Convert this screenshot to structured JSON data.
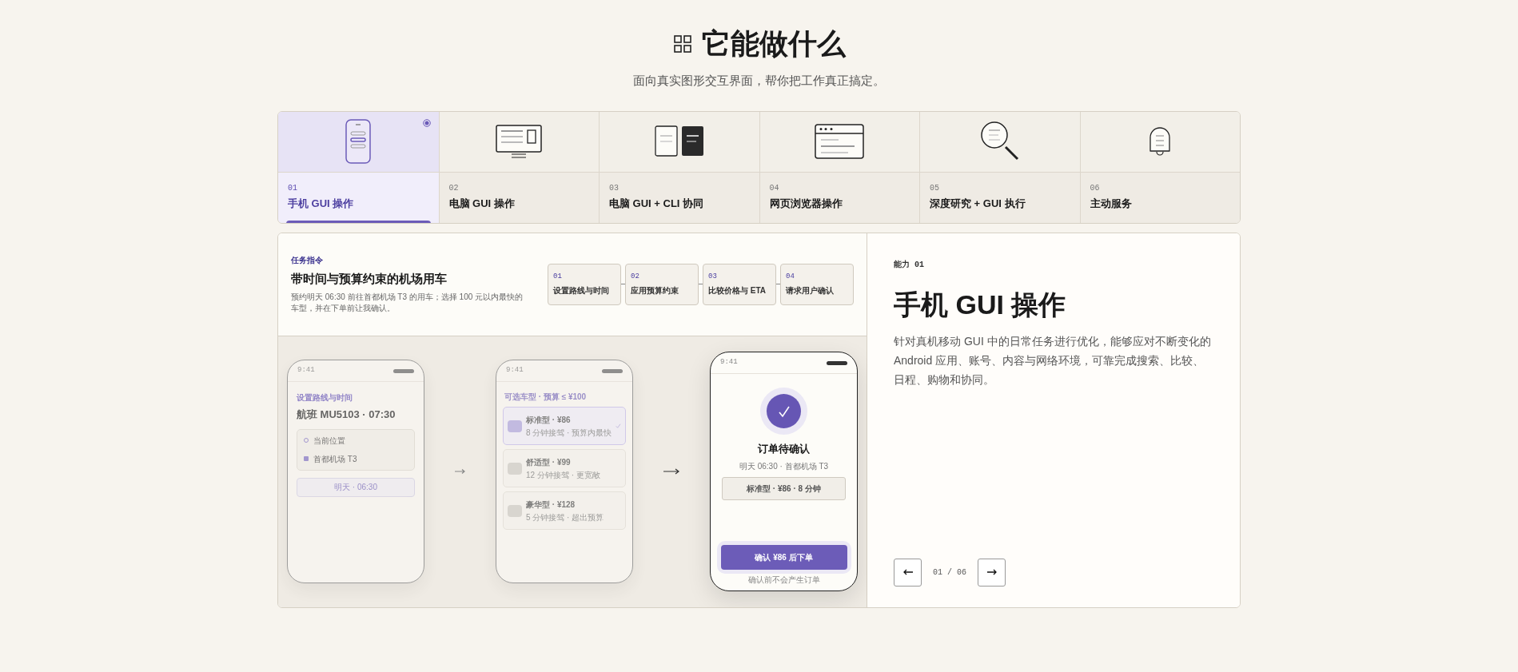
{
  "header": {
    "title": "它能做什么",
    "subtitle": "面向真实图形交互界面，帮你把工作真正搞定。"
  },
  "capabilities": [
    {
      "number": "01",
      "label": "手机 GUI 操作",
      "kind": "phone",
      "selected": true
    },
    {
      "number": "02",
      "label": "电脑 GUI 操作",
      "kind": "monitor",
      "selected": false
    },
    {
      "number": "03",
      "label": "电脑 GUI + CLI 协同",
      "kind": "split",
      "selected": false
    },
    {
      "number": "04",
      "label": "网页浏览器操作",
      "kind": "browser",
      "selected": false
    },
    {
      "number": "05",
      "label": "深度研究 + GUI 执行",
      "kind": "magnifier",
      "selected": false
    },
    {
      "number": "06",
      "label": "主动服务",
      "kind": "bell",
      "selected": false
    }
  ],
  "task": {
    "eyebrow": "任务指令",
    "title": "带时间与预算约束的机场用车",
    "description": "预约明天 06:30 前往首都机场 T3 的用车；选择 100 元以内最快的车型，并在下单前让我确认。",
    "steps": [
      {
        "number": "01",
        "label": "设置路线与时间"
      },
      {
        "number": "02",
        "label": "应用预算约束"
      },
      {
        "number": "03",
        "label": "比较价格与 ETA"
      },
      {
        "number": "04",
        "label": "请求用户确认"
      }
    ]
  },
  "route_screen": {
    "time": "9:41",
    "eyebrow": "设置路线与时间",
    "title": "航班 MU5103 · 07:30",
    "stops": [
      {
        "label": "当前位置",
        "kind": "origin"
      },
      {
        "label": "首都机场 T3",
        "kind": "destination"
      }
    ],
    "when": "明天 · 06:30"
  },
  "options_screen": {
    "time": "9:41",
    "header": "可选车型 · 预算 ≤ ¥100",
    "options": [
      {
        "title": "标准型 · ¥86",
        "subtitle": "8 分钟接驾 · 预算内最快",
        "selected": true
      },
      {
        "title": "舒适型 · ¥99",
        "subtitle": "12 分钟接驾 · 更宽敞",
        "selected": false
      },
      {
        "title": "豪华型 · ¥128",
        "subtitle": "5 分钟接驾 · 超出预算",
        "selected": false
      }
    ]
  },
  "confirm_screen": {
    "time": "9:41",
    "title": "订单待确认",
    "detail": "明天 06:30 · 首都机场 T3",
    "summary": "标准型 · ¥86 · 8 分钟",
    "button": "确认 ¥86 后下单",
    "note": "确认前不会产生订单"
  },
  "detail": {
    "eyebrow": "能力 01",
    "title": "手机 GUI 操作",
    "description": "针对真机移动 GUI 中的日常任务进行优化，能够应对不断变化的 Android 应用、账号、内容与网络环境，可靠完成搜索、比较、日程、购物和协同。",
    "pager": "01 / 06"
  }
}
